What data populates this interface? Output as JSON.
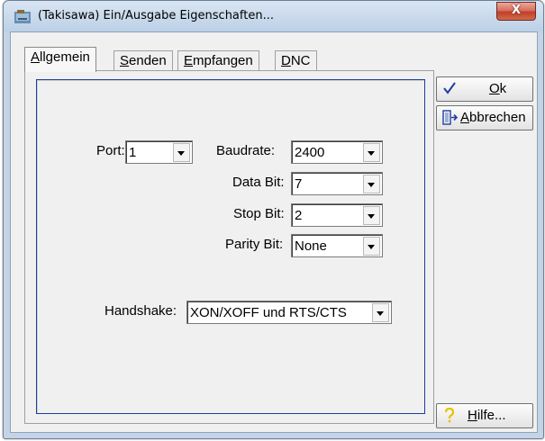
{
  "window": {
    "title": "(Takisawa) Ein/Ausgabe Eigenschaften...",
    "close_glyph": "X"
  },
  "tabs": [
    {
      "label": "Allgemein",
      "accel": "A",
      "rest": "llgemein",
      "active": true
    },
    {
      "label": "Senden",
      "accel": "S",
      "rest": "enden",
      "active": false
    },
    {
      "label": "Empfangen",
      "accel": "E",
      "rest": "mpfangen",
      "active": false
    },
    {
      "label": "DNC",
      "accel": "D",
      "rest": "NC",
      "active": false
    }
  ],
  "form": {
    "port": {
      "label": "Port:",
      "value": "1"
    },
    "baudrate": {
      "label": "Baudrate:",
      "value": "2400"
    },
    "data_bit": {
      "label": "Data Bit:",
      "value": "7"
    },
    "stop_bit": {
      "label": "Stop Bit:",
      "value": "2"
    },
    "parity_bit": {
      "label": "Parity Bit:",
      "value": "None"
    },
    "handshake": {
      "label": "Handshake:",
      "value": "XON/XOFF und RTS/CTS"
    }
  },
  "buttons": {
    "ok": {
      "accel": "O",
      "rest": "k",
      "icon": "checkmark-icon"
    },
    "abbrechen": {
      "accel": "A",
      "rest": "bbrechen",
      "icon": "exit-door-icon"
    },
    "hilfe": {
      "accel": "H",
      "rest": "ilfe...",
      "icon": "question-mark-icon"
    }
  },
  "colors": {
    "panel_border": "#1c3e9b",
    "ok_check": "#1f3f9f",
    "help_icon": "#e8c200",
    "close_button": "#c0402a"
  }
}
